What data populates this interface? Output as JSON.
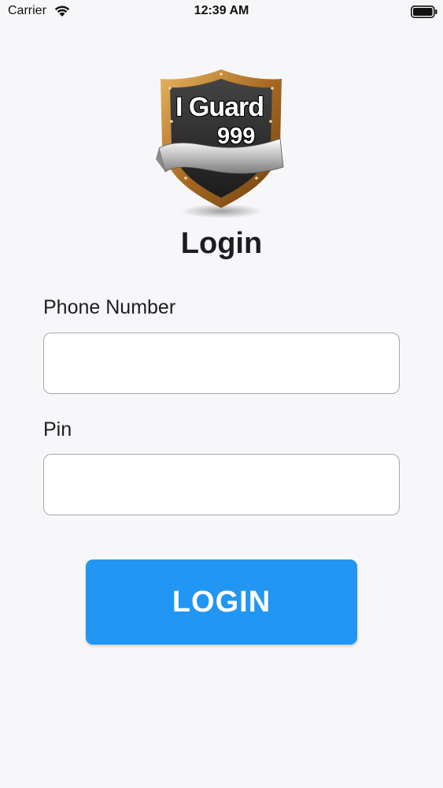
{
  "status_bar": {
    "carrier": "Carrier",
    "time": "12:39 AM",
    "wifi_icon": "wifi-icon",
    "battery_icon": "battery-icon"
  },
  "logo": {
    "line1": "I Guard",
    "line2": "999",
    "icon": "shield-icon"
  },
  "title": "Login",
  "form": {
    "phone_label": "Phone Number",
    "phone_value": "",
    "pin_label": "Pin",
    "pin_value": ""
  },
  "login_button_label": "LOGIN",
  "colors": {
    "accent": "#2196f3",
    "background": "#f7f7f9",
    "shield_border": "#b7782c"
  }
}
